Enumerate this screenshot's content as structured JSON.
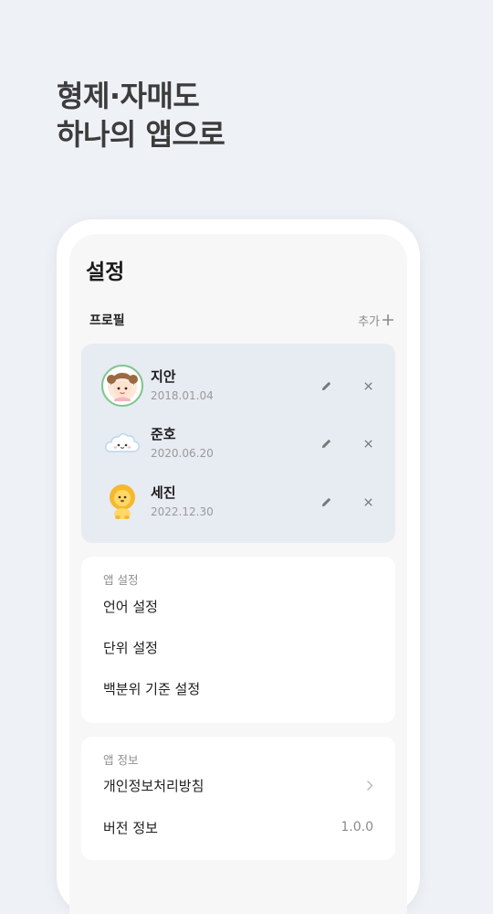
{
  "headline": {
    "line1": "형제·자매도",
    "line2": "하나의 앱으로"
  },
  "screen": {
    "title": "설정",
    "profile_section": {
      "label": "프로필",
      "add_label": "추가",
      "profiles": [
        {
          "name": "지안",
          "date": "2018.01.04",
          "avatar": "girl-avatar"
        },
        {
          "name": "준호",
          "date": "2020.06.20",
          "avatar": "cloud-avatar"
        },
        {
          "name": "세진",
          "date": "2022.12.30",
          "avatar": "lion-avatar"
        }
      ]
    },
    "app_settings": {
      "label": "앱 설정",
      "items": [
        "언어 설정",
        "단위 설정",
        "백분위 기준 설정"
      ]
    },
    "app_info": {
      "label": "앱 정보",
      "privacy_label": "개인정보처리방침",
      "version_label": "버전 정보",
      "version_value": "1.0.0"
    }
  },
  "colors": {
    "background": "#eef1f6",
    "profile_card": "#e7ebf2",
    "avatar_ring": "#7fc68d"
  }
}
